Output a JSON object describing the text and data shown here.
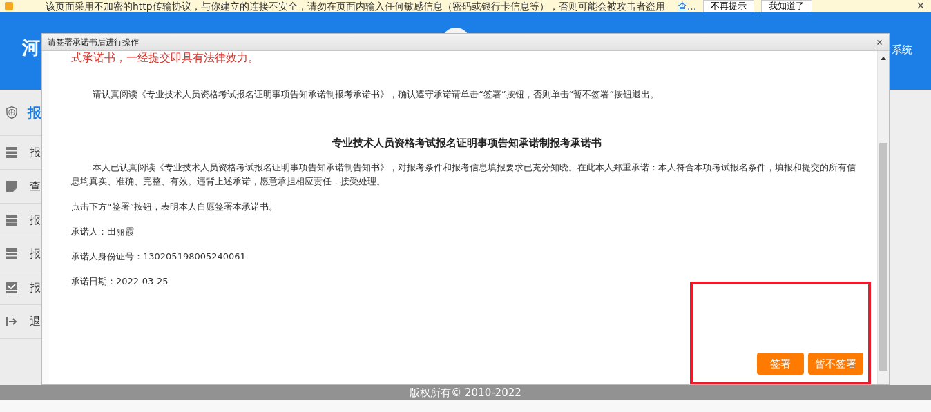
{
  "warning_bar": {
    "text": "该页面采用不加密的http传输协议，与你建立的连接不安全，请勿在页面内输入任何敏感信息（密码或银行卡信息等），否则可能会被攻击者盗用",
    "link": "查...",
    "buttons": [
      "不再提示",
      "我知道了"
    ]
  },
  "header": {
    "title": "河",
    "right_text": "系统"
  },
  "sidebar": {
    "header": "报",
    "items": [
      {
        "label": "报"
      },
      {
        "label": "查"
      },
      {
        "label": "报"
      },
      {
        "label": "报"
      },
      {
        "label": "报"
      },
      {
        "label": "退"
      }
    ]
  },
  "modal": {
    "title": "请签署承诺书后进行操作",
    "notice": "式承诺书，一经提交即具有法律效力。",
    "instruction": "请认真阅读《专业技术人员资格考试报名证明事项告知承诺制报考承诺书》，确认遵守承诺请单击“签署”按钮，否则单击“暂不签署”按钮退出。",
    "document_title": "专业技术人员资格考试报名证明事项告知承诺制报考承诺书",
    "body": "本人已认真阅读《专业技术人员资格考试报名证明事项告知承诺制告知书》，对报考条件和报考信息填报要求已充分知晓。在此本人郑重承诺：本人符合本项考试报名条件，填报和提交的所有信息均真实、准确、完整、有效。违背上述承诺，愿意承担相应责任，接受处理。",
    "lines": [
      "点击下方“签署”按钮，表明本人自愿签署本承诺书。",
      "承诺人：田丽霞",
      "承诺人身份证号：130205198005240061",
      "承诺日期：2022-03-25"
    ],
    "buttons": [
      {
        "label": "签署"
      },
      {
        "label": "暂不签署"
      }
    ]
  },
  "footer": {
    "copyright": "版权所有© 2010-2022"
  }
}
